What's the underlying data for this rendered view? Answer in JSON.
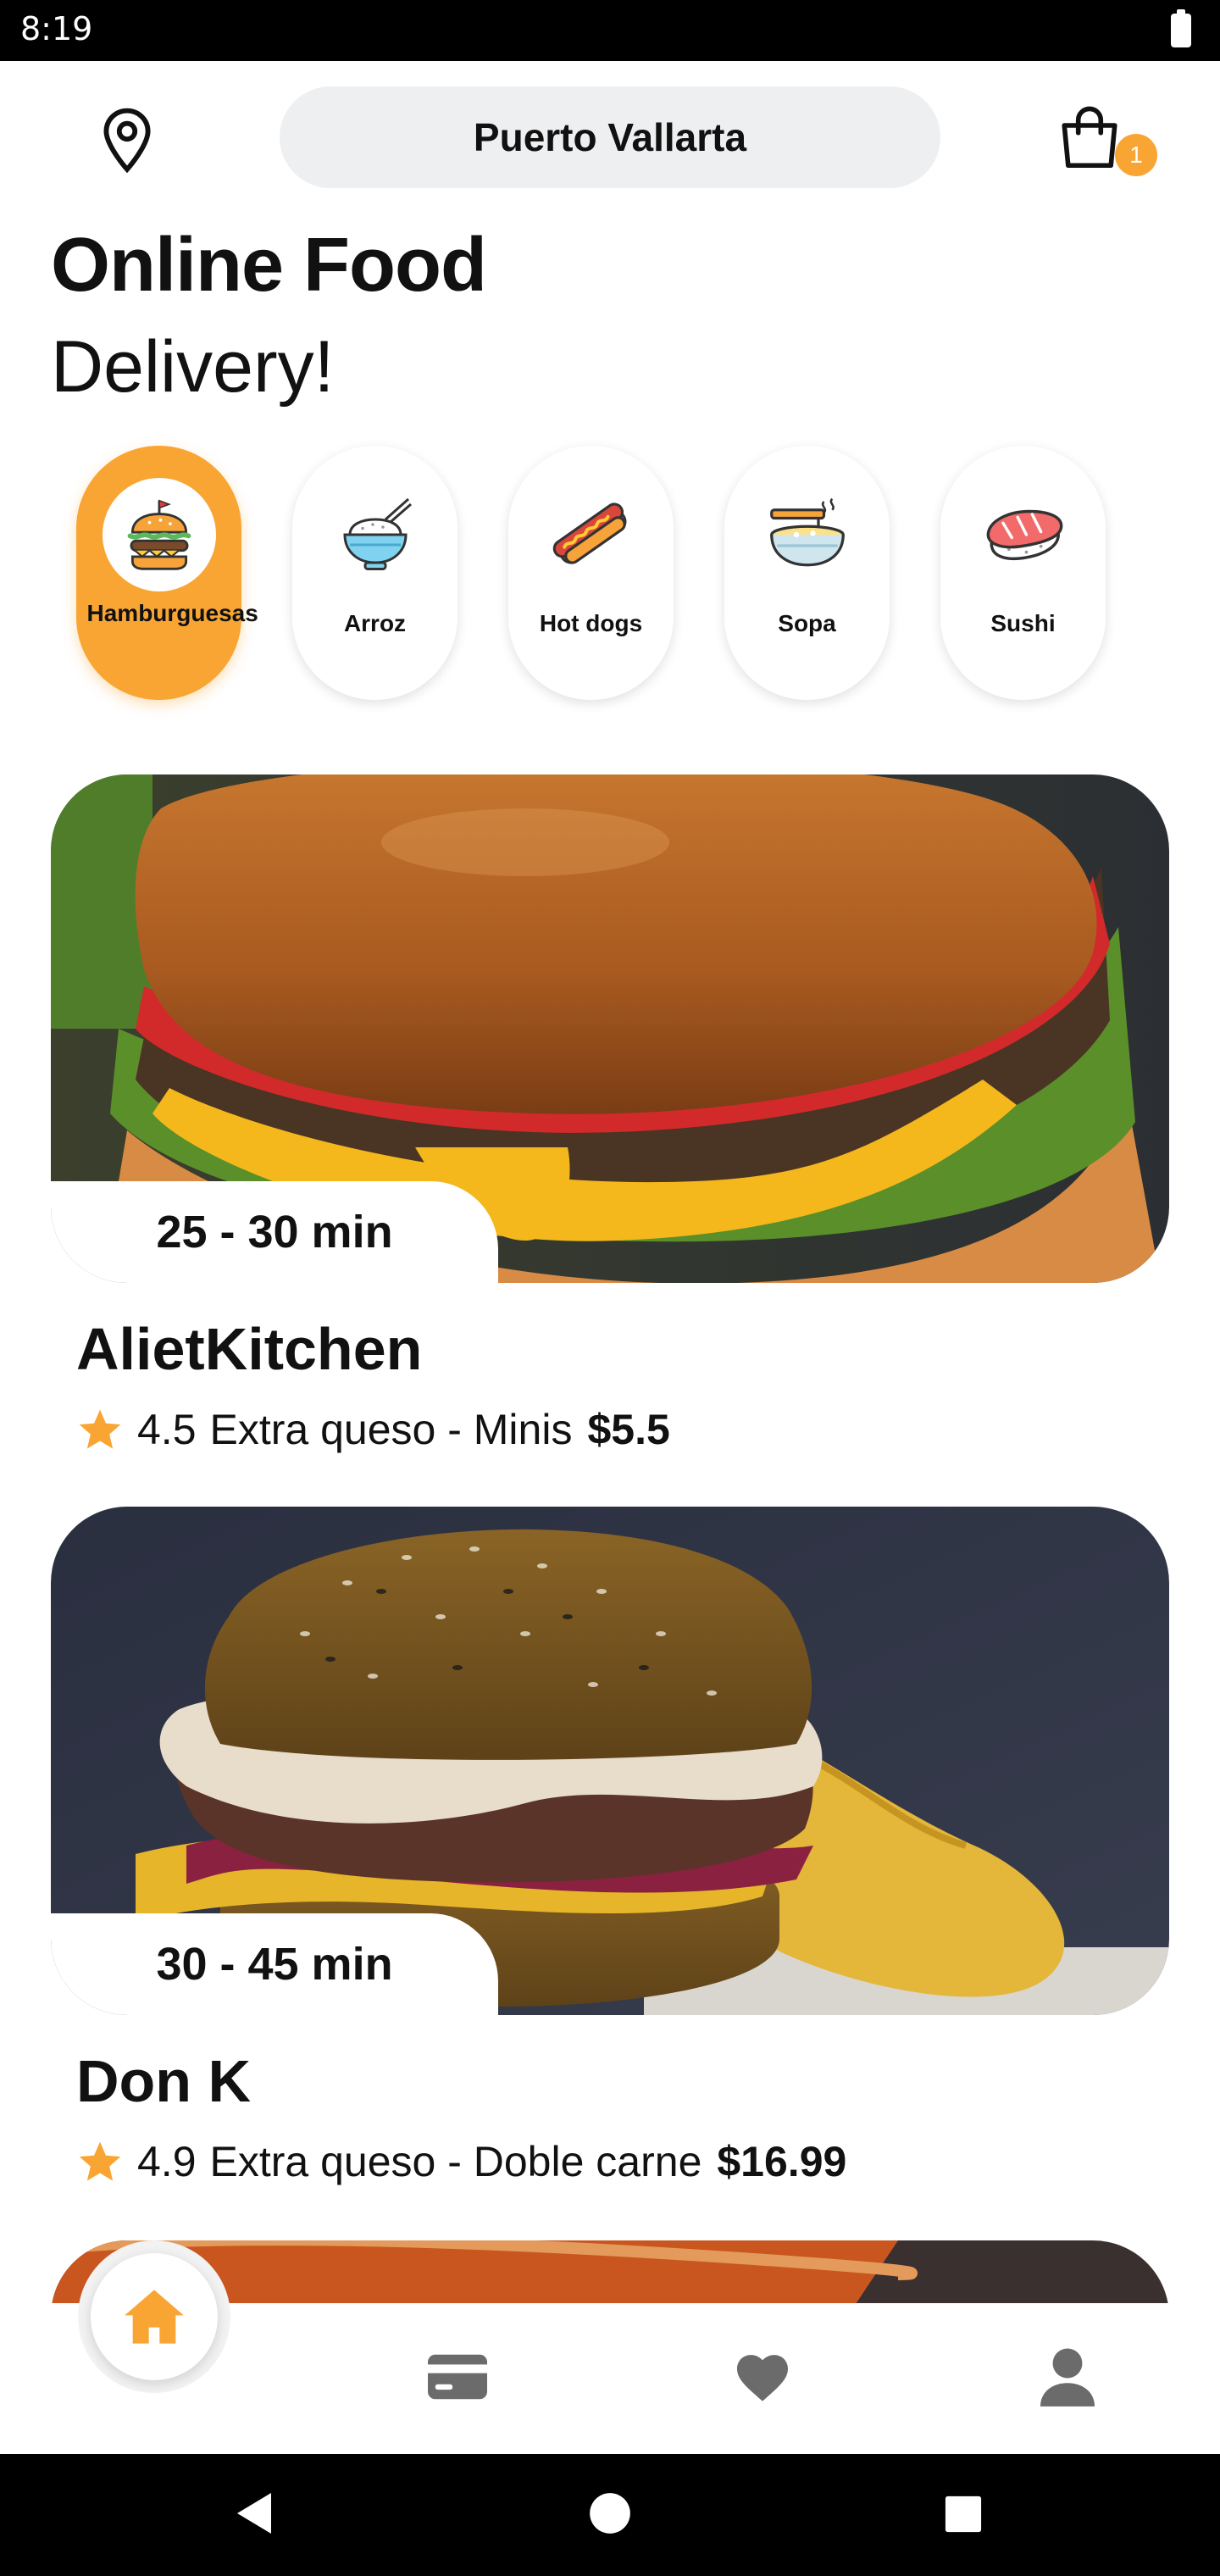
{
  "status_bar": {
    "time": "8:19"
  },
  "header": {
    "location_icon": "map-pin-icon",
    "city": "Puerto Vallarta",
    "cart_icon": "shopping-bag-icon",
    "cart_count": "1"
  },
  "titles": {
    "line1": "Online Food",
    "line2": "Delivery!"
  },
  "categories": [
    {
      "label": "Hamburguesas",
      "icon": "burger-icon",
      "active": true
    },
    {
      "label": "Arroz",
      "icon": "rice-bowl-icon",
      "active": false
    },
    {
      "label": "Hot dogs",
      "icon": "hot-dog-icon",
      "active": false
    },
    {
      "label": "Sopa",
      "icon": "soup-icon",
      "active": false
    },
    {
      "label": "Sushi",
      "icon": "sushi-icon",
      "active": false
    }
  ],
  "restaurants": [
    {
      "delivery_time": "25 - 30 min",
      "name": "AlietKitchen",
      "rating": "4.5",
      "description": "Extra queso - Minis",
      "price": "$5.5"
    },
    {
      "delivery_time": "30 - 45 min",
      "name": "Don K",
      "rating": "4.9",
      "description": "Extra queso - Doble carne",
      "price": "$16.99"
    }
  ],
  "bottom_nav": [
    {
      "icon": "home-icon",
      "active": true
    },
    {
      "icon": "wallet-card-icon",
      "active": false
    },
    {
      "icon": "heart-icon",
      "active": false
    },
    {
      "icon": "user-icon",
      "active": false
    }
  ],
  "colors": {
    "accent": "#f9a534",
    "pill_bg": "#eeeff1",
    "inactive_icon": "#6b6b6b"
  }
}
